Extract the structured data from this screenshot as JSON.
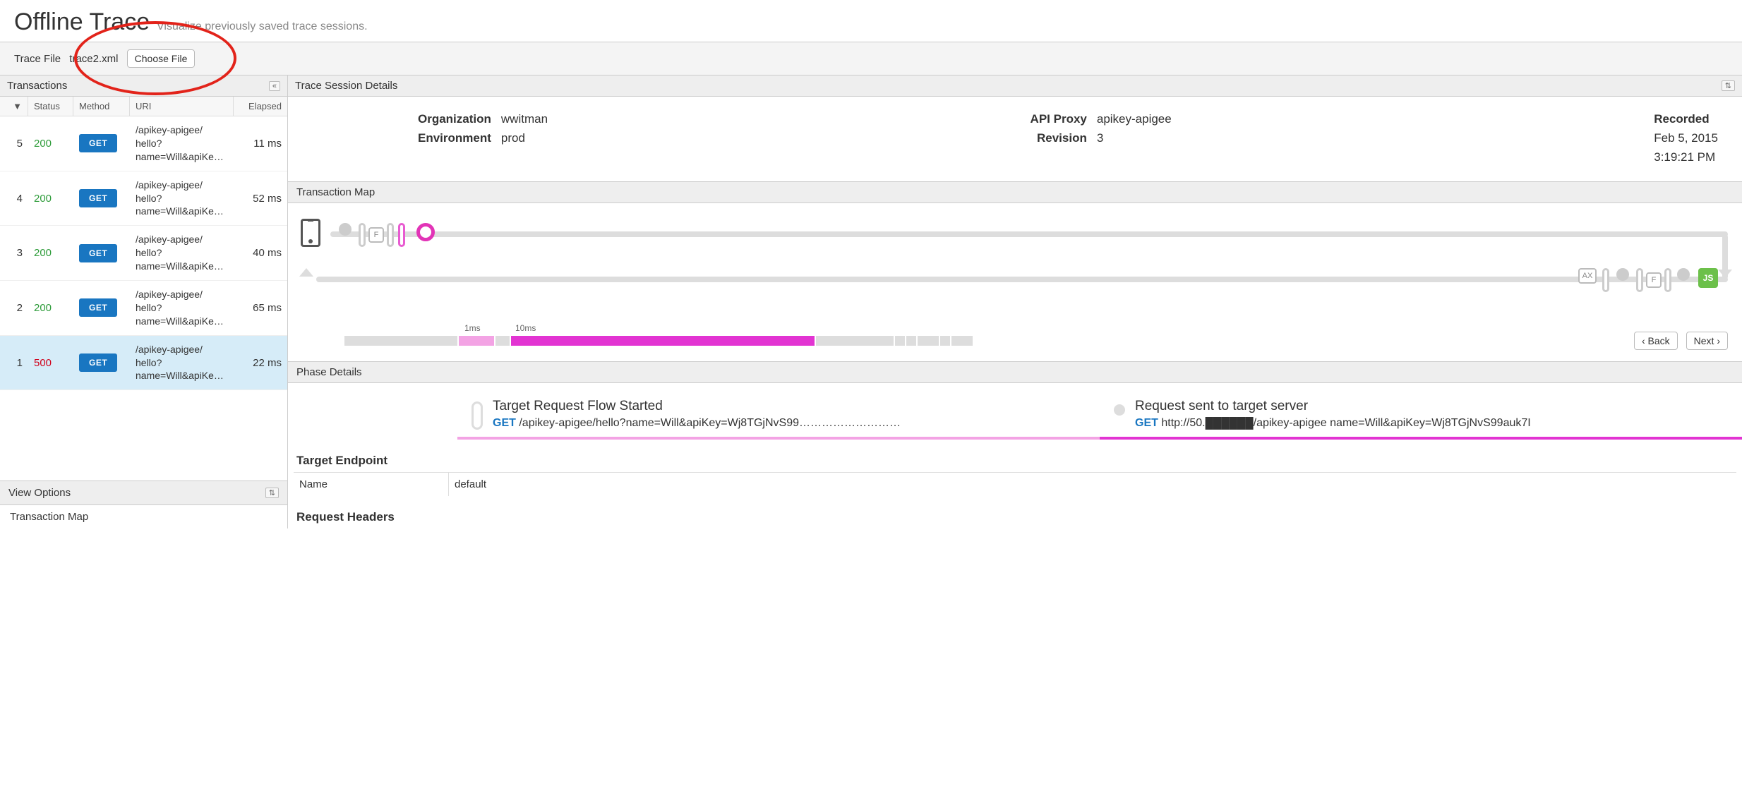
{
  "page": {
    "title": "Offline Trace",
    "subtitle": "Visualize previously saved trace sessions."
  },
  "traceFile": {
    "label": "Trace File",
    "filename": "trace2.xml",
    "chooseLabel": "Choose File"
  },
  "transactionsPanel": {
    "title": "Transactions",
    "collapse": "«",
    "headers": {
      "idx": "▼",
      "status": "Status",
      "method": "Method",
      "uri": "URI",
      "elapsed": "Elapsed"
    }
  },
  "transactions": [
    {
      "idx": "5",
      "status": "200",
      "statusClass": "st200",
      "method": "GET",
      "uri": "/apikey-apigee/hello?name=Will&apiKe…",
      "elapsed": "11 ms",
      "selected": false
    },
    {
      "idx": "4",
      "status": "200",
      "statusClass": "st200",
      "method": "GET",
      "uri": "/apikey-apigee/hello?name=Will&apiKe…",
      "elapsed": "52 ms",
      "selected": false
    },
    {
      "idx": "3",
      "status": "200",
      "statusClass": "st200",
      "method": "GET",
      "uri": "/apikey-apigee/hello?name=Will&apiKe…",
      "elapsed": "40 ms",
      "selected": false
    },
    {
      "idx": "2",
      "status": "200",
      "statusClass": "st200",
      "method": "GET",
      "uri": "/apikey-apigee/hello?name=Will&apiKe…",
      "elapsed": "65 ms",
      "selected": false
    },
    {
      "idx": "1",
      "status": "500",
      "statusClass": "st500",
      "method": "GET",
      "uri": "/apikey-apigee/hello?name=Will&apiKe…",
      "elapsed": "22 ms",
      "selected": true
    }
  ],
  "viewOptions": {
    "title": "View Options",
    "toggle": "⇅",
    "item1": "Transaction Map"
  },
  "details": {
    "panelTitle": "Trace Session Details",
    "orgLabel": "Organization",
    "org": "wwitman",
    "envLabel": "Environment",
    "env": "prod",
    "proxyLabel": "API Proxy",
    "proxy": "apikey-apigee",
    "revLabel": "Revision",
    "rev": "3",
    "recordedLabel": "Recorded",
    "recordedDate": "Feb 5, 2015",
    "recordedTime": "3:19:21 PM"
  },
  "map": {
    "title": "Transaction Map",
    "t1": "1ms",
    "t2": "10ms",
    "ax": "AX",
    "f": "F",
    "js": "JS",
    "back": "‹ Back",
    "next": "Next ›"
  },
  "phase": {
    "title": "Phase Details",
    "card1": {
      "title": "Target Request Flow Started",
      "verb": "GET",
      "path": "/apikey-apigee/hello?name=Will&apiKey=Wj8TGjNvS99………………………"
    },
    "card2": {
      "title": "Request sent to target server",
      "verb": "GET",
      "path": "http://50.██████/apikey-apigee  name=Will&apiKey=Wj8TGjNvS99auk7I"
    }
  },
  "endpoint": {
    "title": "Target Endpoint",
    "nameLabel": "Name",
    "nameValue": "default"
  },
  "reqHeaders": {
    "title": "Request Headers"
  }
}
